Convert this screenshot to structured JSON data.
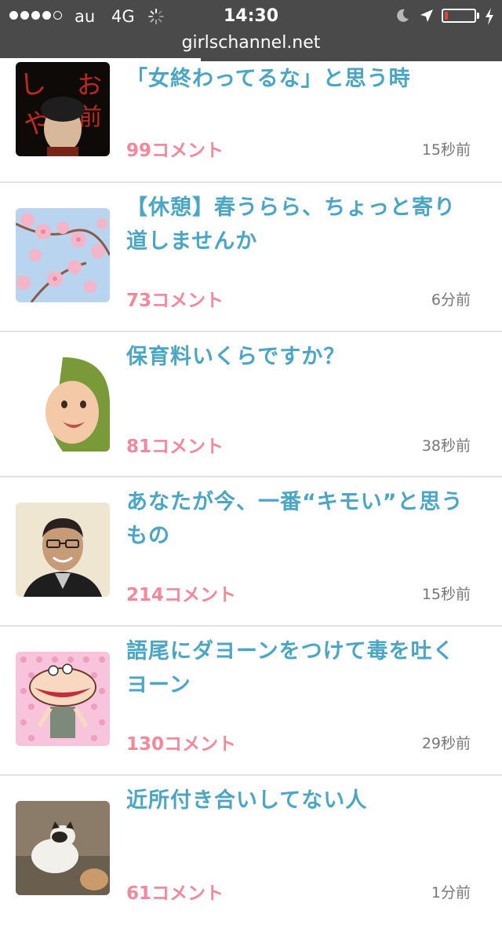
{
  "status_bar": {
    "carrier": "au",
    "network": "4G",
    "time": "14:30",
    "url": "girlschannel.net",
    "signal_dots_filled": 4,
    "signal_dots_total": 5,
    "battery_level": 0.1,
    "page_load_progress": 0.4
  },
  "topics": [
    {
      "title": "「女終わってるな」と思う時",
      "comments": "99コメント",
      "time": "15秒前",
      "thumb": "dark-poster"
    },
    {
      "title": "【休憩】春うらら、ちょっと寄り道しませんか",
      "comments": "73コメント",
      "time": "6分前",
      "thumb": "cherry-blossoms"
    },
    {
      "title": "保育料いくらですか？",
      "comments": "81コメント",
      "time": "38秒前",
      "thumb": "baby-in-towel"
    },
    {
      "title": "あなたが今、一番“キモい”と思うもの",
      "comments": "214コメント",
      "time": "15秒前",
      "thumb": "smiling-man"
    },
    {
      "title": "語尾にダヨーンをつけて毒を吐くヨーン",
      "comments": "130コメント",
      "time": "29秒前",
      "thumb": "cartoon-dayon"
    },
    {
      "title": "近所付き合いしてない人",
      "comments": "61コメント",
      "time": "1分前",
      "thumb": "cats"
    }
  ],
  "colors": {
    "title": "#4aa6c4",
    "comments": "#f2889a",
    "time": "#777777",
    "status_bar": "#4a4a4a"
  }
}
